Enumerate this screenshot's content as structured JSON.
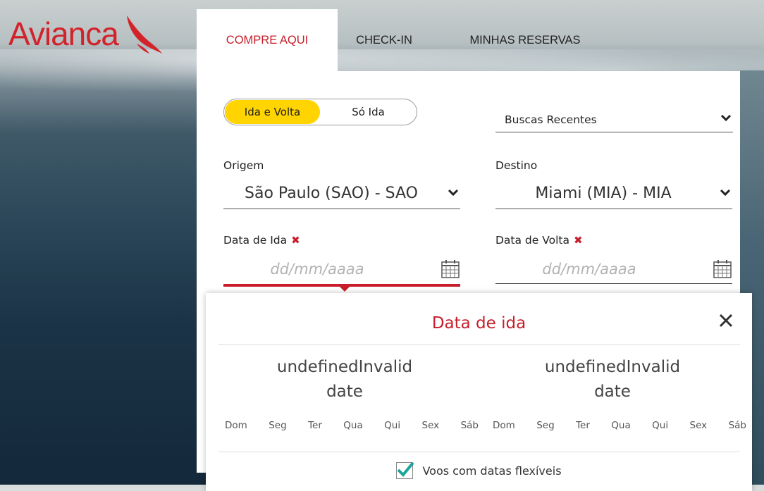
{
  "brand": {
    "name": "Avianca",
    "color": "#d2232a"
  },
  "tabs": [
    {
      "label": "COMPRE AQUI",
      "active": true
    },
    {
      "label": "CHECK-IN",
      "active": false
    },
    {
      "label": "MINHAS RESERVAS",
      "active": false
    }
  ],
  "trip_type": {
    "options": [
      "Ida e Volta",
      "Só Ida"
    ],
    "selected": "Ida e Volta",
    "selected_color": "#ffd400"
  },
  "recent_searches": {
    "label": "Buscas Recentes",
    "icon": "chevron-down-icon"
  },
  "origin": {
    "label": "Origem",
    "value": "São Paulo (SAO) - SAO"
  },
  "destination": {
    "label": "Destino",
    "value": "Miami (MIA) - MIA"
  },
  "departure_date": {
    "label": "Data de Ida",
    "placeholder": "dd/mm/aaaa",
    "required_icon": "red-x-icon"
  },
  "return_date": {
    "label": "Data de Volta",
    "placeholder": "dd/mm/aaaa",
    "required_icon": "red-x-icon"
  },
  "datepicker": {
    "title": "Data de ida",
    "months": [
      {
        "line1": "undefinedInvalid",
        "line2": "date"
      },
      {
        "line1": "undefinedInvalid",
        "line2": "date"
      }
    ],
    "weekdays": [
      "Dom",
      "Seg",
      "Ter",
      "Qua",
      "Qui",
      "Sex",
      "Sáb"
    ],
    "flexible_dates": {
      "label": "Voos com datas flexíveis",
      "checked": true
    },
    "accent_color": "#c81e2b",
    "check_color": "#1aa59a"
  }
}
